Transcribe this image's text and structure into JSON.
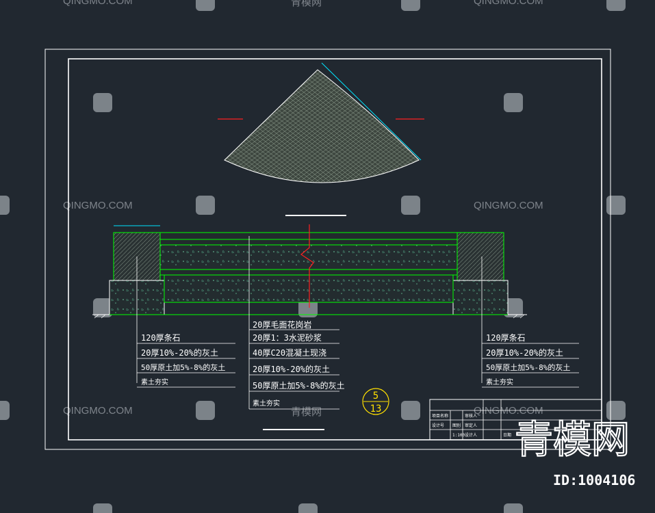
{
  "watermark": {
    "site_latin": "QINGMO.COM",
    "site_cn": "青模网"
  },
  "drawing": {
    "section_marker": {
      "number": "5",
      "sheet": "13"
    },
    "center_notes": [
      "20厚毛面花岗岩",
      "20厚1：3水泥砂浆",
      "40厚C20混凝土现浇",
      "20厚10%-20%的灰土",
      "50厚原土加5%-8%的灰土",
      "素土夯实"
    ],
    "left_notes": [
      "120厚条石",
      "20厚10%-20%的灰土",
      "50厚原土加5%-8%的灰土",
      "素土夯实"
    ],
    "right_notes": [
      "120厚条石",
      "20厚10%-20%的灰土",
      "50厚原土加5%-8%的灰土",
      "素土夯实"
    ],
    "title_block": {
      "scale": "1:100",
      "cells": [
        "项目名称",
        "设计号",
        "图别",
        "审核人",
        "审定人",
        "设计人",
        "日期"
      ]
    }
  },
  "brand": {
    "logo_text": "青模网",
    "id_label": "ID:1004106"
  },
  "colors": {
    "background": "#212830",
    "frame": "#ffffff",
    "section_lines": "#00ff00",
    "dimension": "#00e5ff",
    "center_mark": "#ff2020",
    "hatch": "#3f4a3f"
  }
}
